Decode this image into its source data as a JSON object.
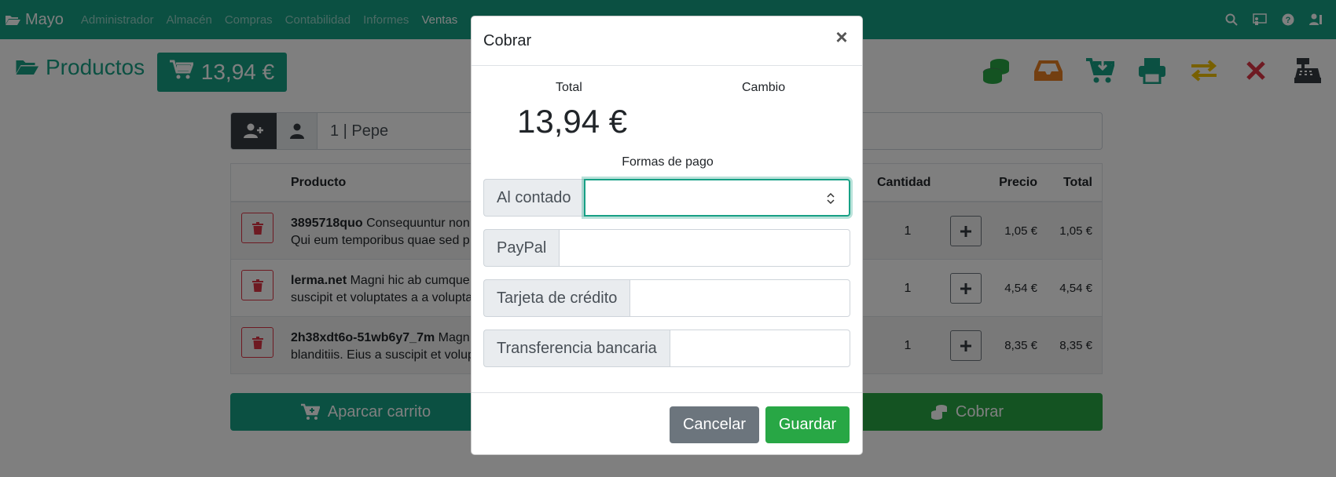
{
  "navbar": {
    "brand": "Mayo",
    "menu": [
      "Administrador",
      "Almacén",
      "Compras",
      "Contabilidad",
      "Informes",
      "Ventas"
    ],
    "active_menu": "Ventas",
    "right_icons": [
      "search-icon",
      "chalkboard-icon",
      "question-icon",
      "user-icon"
    ]
  },
  "page": {
    "title": "Productos",
    "cart_total": "13,94 €"
  },
  "toolbar": {
    "icons": [
      "coins-icon",
      "inbox-icon",
      "cart-arrow-down-icon",
      "print-icon",
      "exchange-icon",
      "close-icon",
      "cash-register-icon"
    ]
  },
  "customer": {
    "value": "1 | Pepe"
  },
  "table": {
    "columns": {
      "product": "Producto",
      "quantity": "Cantidad",
      "price": "Precio",
      "total": "Total"
    },
    "rows": [
      {
        "ref": "3895718quo",
        "line1": "Consequuntur non",
        "line2": "Qui eum temporibus quae sed p",
        "quantity": "1",
        "price": "1,05 €",
        "total": "1,05 €"
      },
      {
        "ref": "lerma.net",
        "line1": "Magni hic ab cumque",
        "line2": "suscipit et voluptates a a volupta",
        "quantity": "1",
        "price": "4,54 €",
        "total": "4,54 €"
      },
      {
        "ref": "2h38xdt6o-51wb6y7_7m",
        "line1": "Magn",
        "line2": "blanditiis. Eius a suscipit et volup",
        "quantity": "1",
        "price": "8,35 €",
        "total": "8,35 €"
      }
    ]
  },
  "buttons": {
    "park": "Aparcar carrito",
    "charge": "Cobrar"
  },
  "modal": {
    "title": "Cobrar",
    "total_label": "Total",
    "change_label": "Cambio",
    "total_amount": "13,94 €",
    "payment_methods_label": "Formas de pago",
    "payment_methods": [
      {
        "label": "Al contado",
        "value": ""
      },
      {
        "label": "PayPal",
        "value": ""
      },
      {
        "label": "Tarjeta de crédito",
        "value": ""
      },
      {
        "label": "Transferencia bancaria",
        "value": ""
      }
    ],
    "cancel": "Cancelar",
    "save": "Guardar"
  },
  "colors": {
    "primary": "#17a085",
    "success": "#28a745",
    "danger": "#dc3545",
    "warning": "#e67e22",
    "yellow": "#f0c000",
    "dark": "#343a40",
    "secondary": "#6c757d"
  }
}
